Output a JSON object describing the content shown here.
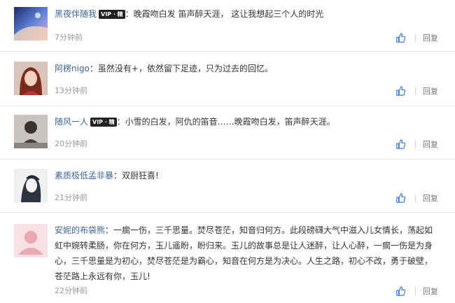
{
  "comments": [
    {
      "user": "黑夜伴随我",
      "vip_badge": "VIP · 精",
      "text": "晚霞吻白发 笛声醉天涯， 这让我想起三个人的时光",
      "time": "7分钟前",
      "reply_label": "回复",
      "avatar_icon": "avatar-night-sky"
    },
    {
      "user": "阿楞nigo",
      "vip_badge": "",
      "text": "虽然没有+，依然留下足迹，只为过去的回忆。",
      "time": "13分钟前",
      "reply_label": "回复",
      "avatar_icon": "avatar-girl-red"
    },
    {
      "user": "随风一人",
      "vip_badge": "VIP · 精",
      "text": "小雪的白发，阿仇的笛音……晚霞吻白发，笛声醉天涯。",
      "time": "20分钟前",
      "reply_label": "回复",
      "avatar_icon": "avatar-silhouette"
    },
    {
      "user": "素质极低孟非暴",
      "vip_badge": "",
      "text": "双厨狂喜!",
      "time": "21分钟前",
      "reply_label": "回复",
      "avatar_icon": "avatar-sketch"
    },
    {
      "user": "安妮的布袋熊",
      "vip_badge": "",
      "text": "一瘸一伤，三千思量。焚尽苍茫，知音归何方。此段磅礴大气中滋入儿女情长，荡起如虹中婉转柔肠，你在何方，玉儿遥盼，盼归来。玉儿的故事总是让人迷醉，让人心醉，一瘸一伤是为身心，三千思量是为初心，焚尽苍茫是为霸心，知音在何方是为决心。人生之路，初心不改，勇于破壁，苍茫路上永远有你，玉儿!",
      "time": "22分钟前",
      "reply_label": "回复",
      "avatar_icon": "avatar-default-pink"
    }
  ]
}
